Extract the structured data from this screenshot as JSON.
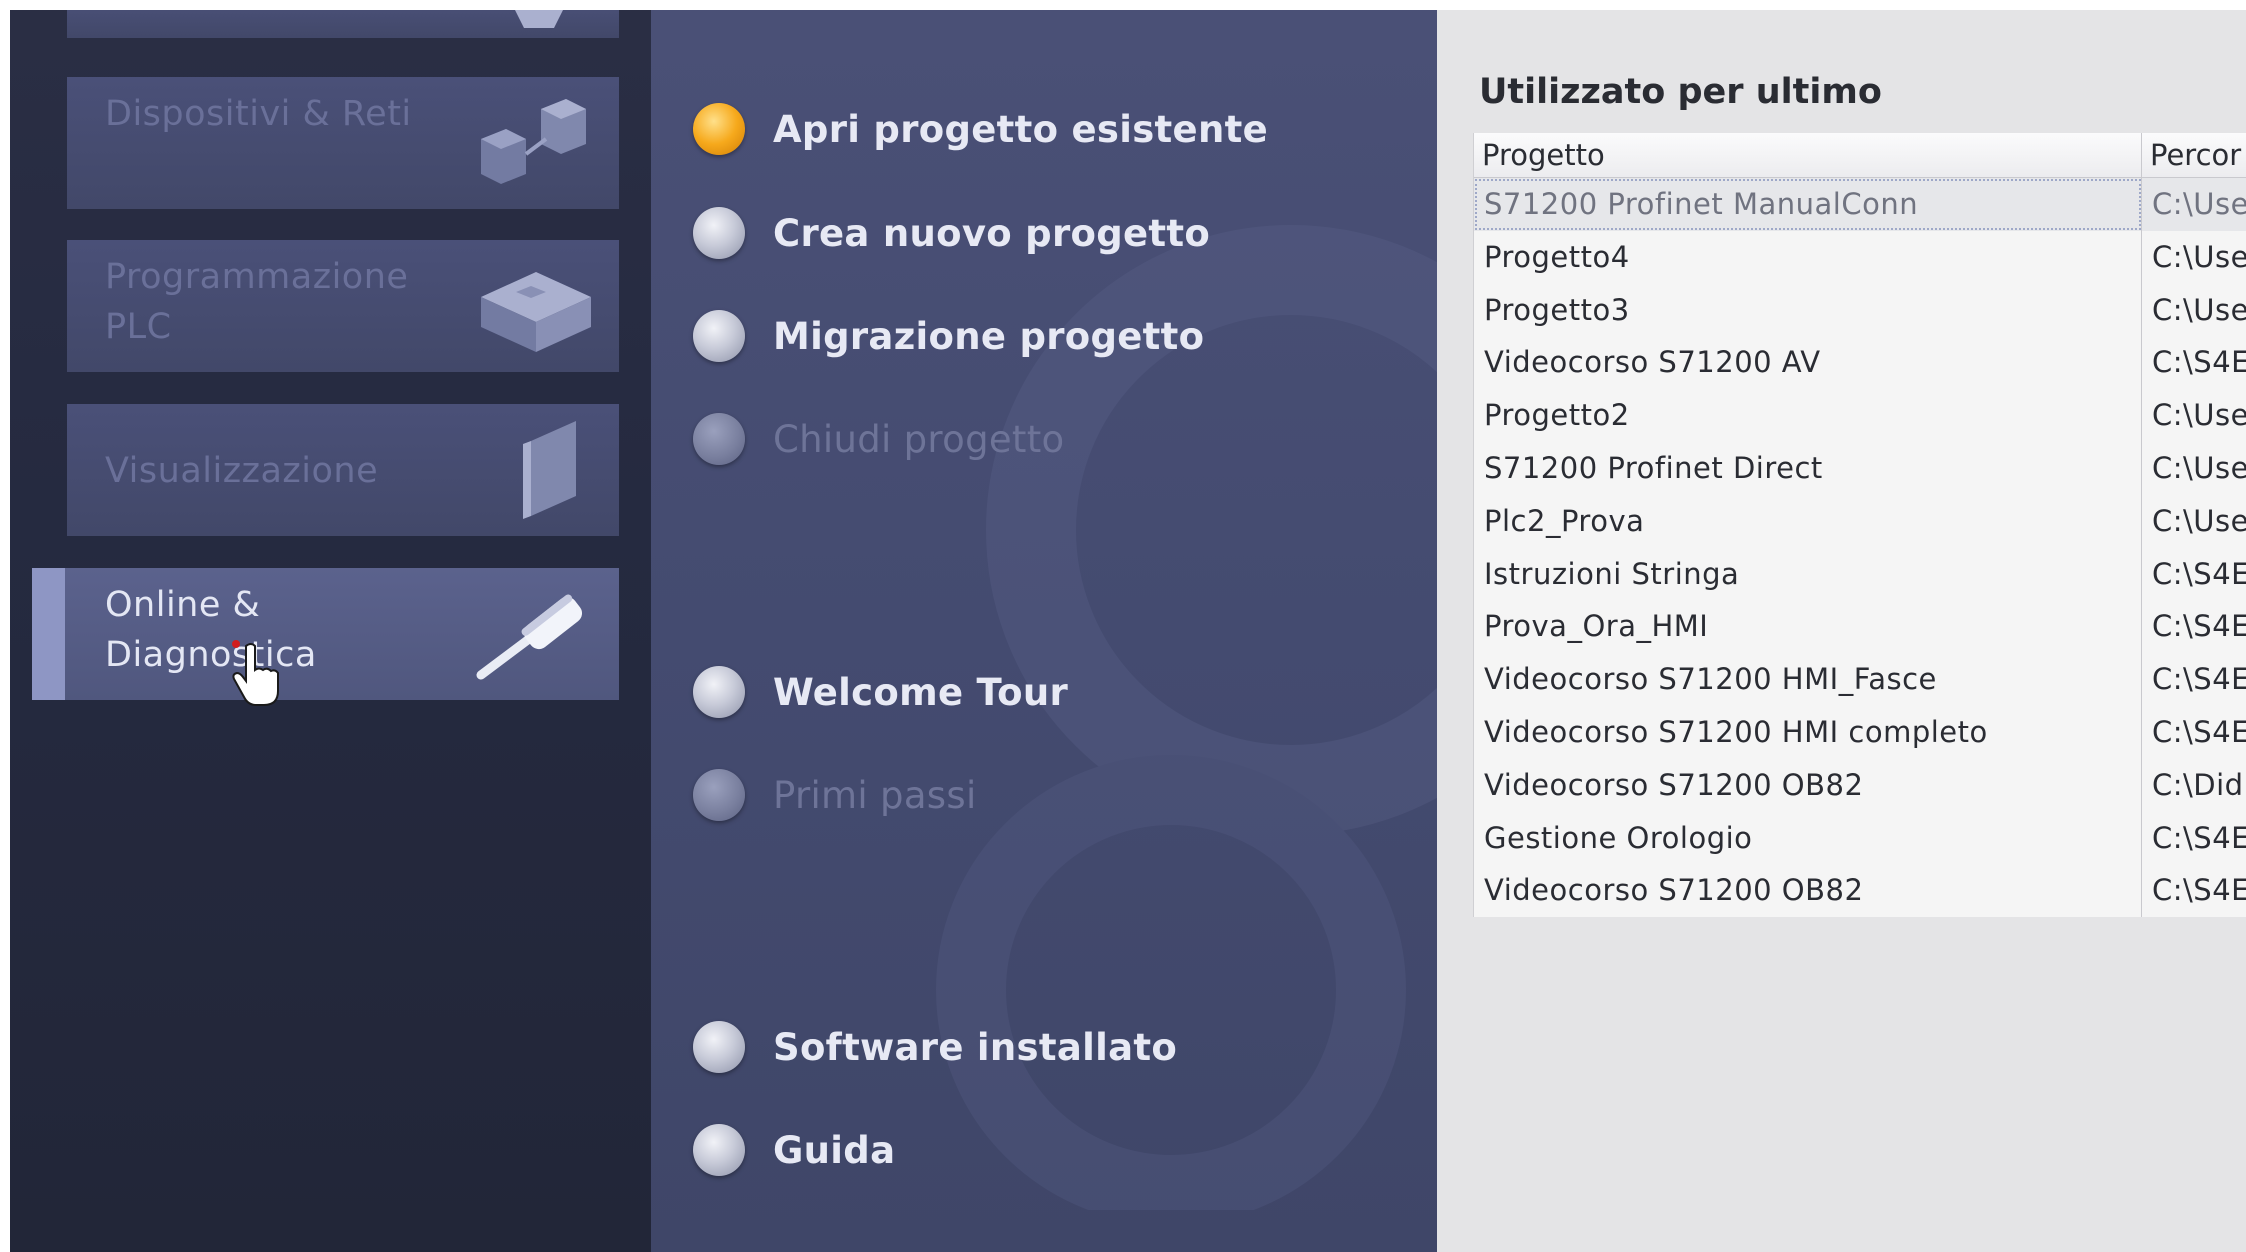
{
  "portal_nav": {
    "items": [
      {
        "label": "Dispositivi & Reti",
        "icon": "network-devices-icon"
      },
      {
        "label": "Programmazione PLC",
        "icon": "plc-block-icon"
      },
      {
        "label": "Visualizzazione",
        "icon": "hmi-panel-icon"
      },
      {
        "label": "Online & Diagnostica",
        "icon": "screwdriver-icon",
        "active": true
      }
    ]
  },
  "portal_actions": {
    "items": [
      {
        "label": "Apri progetto esistente",
        "state": "selected"
      },
      {
        "label": "Crea nuovo progetto",
        "state": "enabled"
      },
      {
        "label": "Migrazione progetto",
        "state": "enabled"
      },
      {
        "label": "Chiudi progetto",
        "state": "disabled"
      },
      {
        "label": "Welcome Tour",
        "state": "enabled"
      },
      {
        "label": "Primi passi",
        "state": "disabled"
      },
      {
        "label": "Software installato",
        "state": "enabled"
      },
      {
        "label": "Guida",
        "state": "enabled"
      }
    ]
  },
  "recent": {
    "title": "Utilizzato per ultimo",
    "columns": [
      "Progetto",
      "Percor"
    ],
    "rows": [
      {
        "project": "S71200 Profinet ManualConn",
        "path": "C:\\Use",
        "selected": true
      },
      {
        "project": "Progetto4",
        "path": "C:\\Use"
      },
      {
        "project": "Progetto3",
        "path": "C:\\Use"
      },
      {
        "project": "Videocorso S71200 AV",
        "path": "C:\\S4E"
      },
      {
        "project": "Progetto2",
        "path": "C:\\Use"
      },
      {
        "project": "S71200 Profinet Direct",
        "path": "C:\\Use"
      },
      {
        "project": "Plc2_Prova",
        "path": "C:\\Use"
      },
      {
        "project": "Istruzioni Stringa",
        "path": "C:\\S4E"
      },
      {
        "project": "Prova_Ora_HMI",
        "path": "C:\\S4E"
      },
      {
        "project": "Videocorso S71200 HMI_Fasce",
        "path": "C:\\S4E"
      },
      {
        "project": "Videocorso S71200 HMI completo",
        "path": "C:\\S4E"
      },
      {
        "project": "Videocorso S71200 OB82",
        "path": "C:\\Did"
      },
      {
        "project": "Gestione Orologio",
        "path": "C:\\S4E"
      },
      {
        "project": "Videocorso S71200 OB82",
        "path": "C:\\S4E"
      }
    ]
  }
}
